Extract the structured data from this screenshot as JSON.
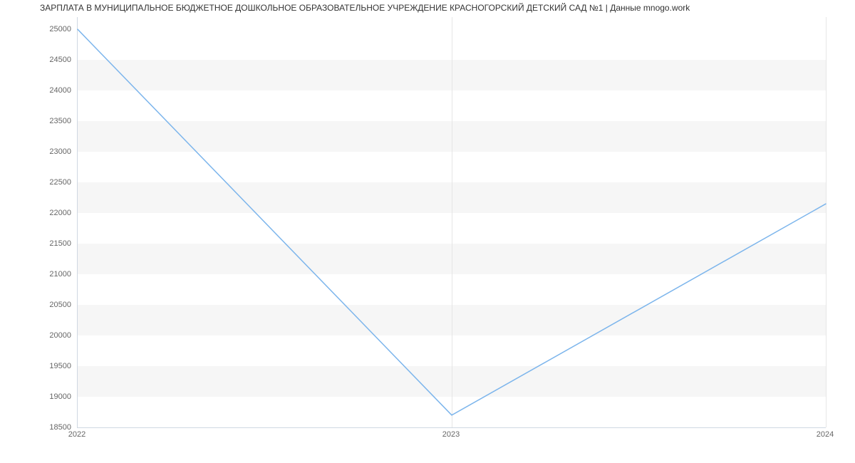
{
  "chart_data": {
    "type": "line",
    "title": "ЗАРПЛАТА В МУНИЦИПАЛЬНОЕ БЮДЖЕТНОЕ ДОШКОЛЬНОЕ ОБРАЗОВАТЕЛЬНОЕ УЧРЕЖДЕНИЕ КРАСНОГОРСКИЙ ДЕТСКИЙ САД №1 | Данные mnogo.work",
    "x": [
      "2022",
      "2023",
      "2024"
    ],
    "values": [
      25000,
      18700,
      22150
    ],
    "xlabel": "",
    "ylabel": "",
    "ylim": [
      18500,
      25200
    ],
    "y_ticks": [
      18500,
      19000,
      19500,
      20000,
      20500,
      21000,
      21500,
      22000,
      22500,
      23000,
      23500,
      24000,
      24500,
      25000
    ],
    "x_ticks": [
      "2022",
      "2023",
      "2024"
    ],
    "line_color": "#7cb5ec"
  }
}
